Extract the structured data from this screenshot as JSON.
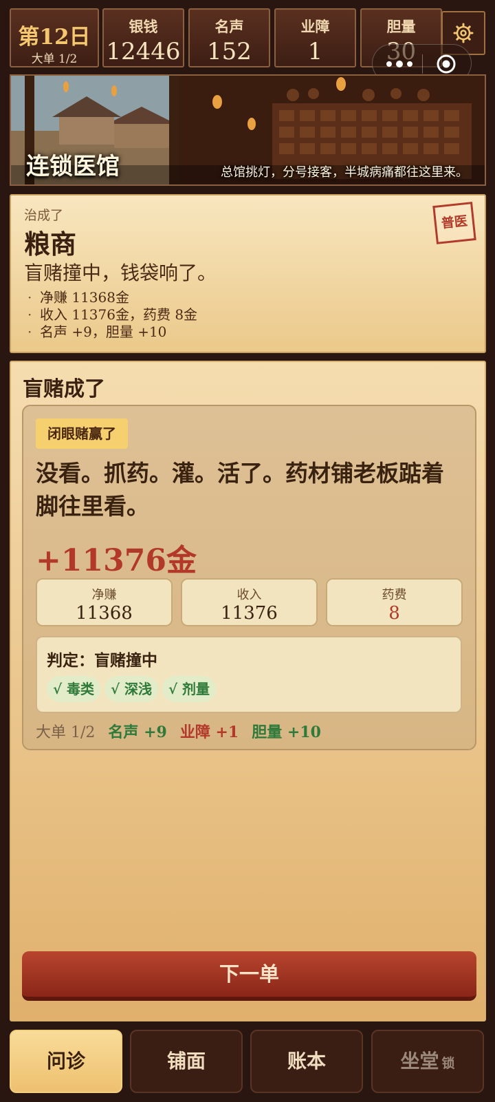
{
  "stats": {
    "day": "第12日",
    "order": "大单 1/2",
    "silver_label": "银钱",
    "silver": "12446",
    "fame_label": "名声",
    "fame": "152",
    "karma_label": "业障",
    "karma": "1",
    "courage_label": "胆量",
    "courage": "30"
  },
  "banner": {
    "title": "连锁医馆",
    "subtitle": "总馆挑灯，分号接客，半城病痛都往这里来。"
  },
  "result": {
    "prefix": "治成了",
    "patient": "粮商",
    "headline": "盲赌撞中，钱袋响了。",
    "bullets": [
      "净赚 11368金",
      "收入 11376金，药费 8金",
      "名声 +9，胆量 +10"
    ],
    "stamp": "普医"
  },
  "main": {
    "title": "盲赌成了",
    "tag": "闭眼赌赢了",
    "story": "没看。抓药。灌。活了。药材铺老板踮着脚往里看。",
    "gold": "+11376金",
    "net_label": "净赚",
    "net": "11368",
    "income_label": "收入",
    "income": "11376",
    "cost_label": "药费",
    "cost": "8",
    "judge": "判定：盲赌撞中",
    "checks": [
      "√ 毒类",
      "√ 深浅",
      "√ 剂量"
    ],
    "summary": {
      "order": "大单 1/2",
      "fame": "名声 +9",
      "karma": "业障 +1",
      "courage": "胆量 +10"
    },
    "next_button": "下一单"
  },
  "tabs": [
    {
      "label": "问诊",
      "active": true
    },
    {
      "label": "铺面",
      "active": false
    },
    {
      "label": "账本",
      "active": false
    },
    {
      "label": "坐堂",
      "locked_label": "锁",
      "active": false
    }
  ],
  "colors": {
    "accent_red": "#b2382a",
    "gold": "#f5c870",
    "positive_green": "#2e7a3a"
  },
  "icons": [
    "gear-icon",
    "more-dots-icon",
    "target-circle-icon",
    "lock-icon"
  ]
}
